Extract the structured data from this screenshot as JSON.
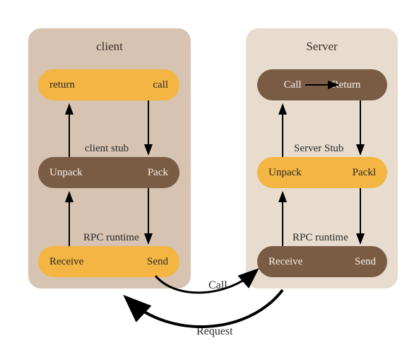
{
  "client": {
    "title": "client",
    "top": {
      "left": "return",
      "right": "call"
    },
    "mid_label": "client stub",
    "mid": {
      "left": "Unpack",
      "right": "Pack"
    },
    "bot_label": "RPC runtime",
    "bot": {
      "left": "Receive",
      "right": "Send"
    }
  },
  "server": {
    "title": "Server",
    "top": {
      "left": "Call",
      "right": "Return"
    },
    "mid_label": "Server Stub",
    "mid": {
      "left": "Unpack",
      "right": "Packl"
    },
    "bot_label": "RPC runtime",
    "bot": {
      "left": "Receive",
      "right": "Send"
    }
  },
  "link": {
    "call": "Call",
    "request": "Request"
  }
}
